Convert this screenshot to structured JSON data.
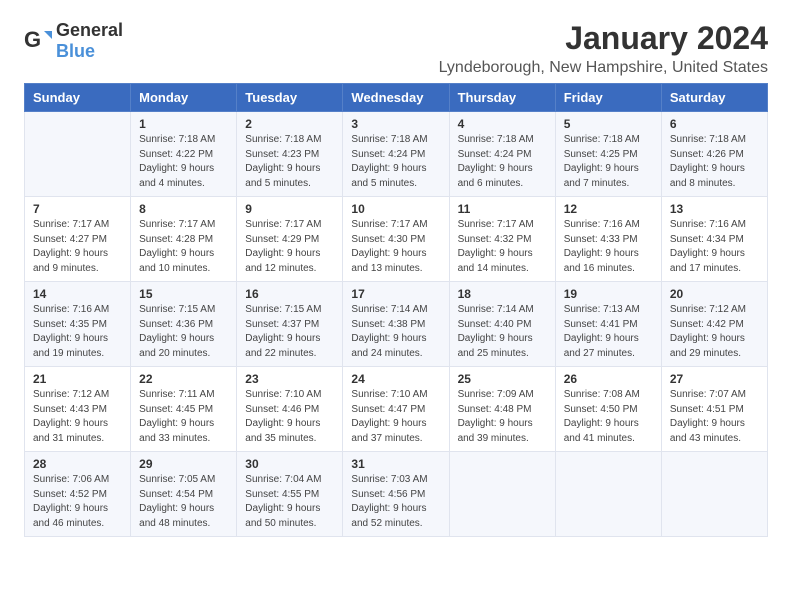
{
  "header": {
    "logo_general": "General",
    "logo_blue": "Blue",
    "title": "January 2024",
    "subtitle": "Lyndeborough, New Hampshire, United States"
  },
  "days_of_week": [
    "Sunday",
    "Monday",
    "Tuesday",
    "Wednesday",
    "Thursday",
    "Friday",
    "Saturday"
  ],
  "weeks": [
    [
      {
        "num": "",
        "sunrise": "",
        "sunset": "",
        "daylight": ""
      },
      {
        "num": "1",
        "sunrise": "Sunrise: 7:18 AM",
        "sunset": "Sunset: 4:22 PM",
        "daylight": "Daylight: 9 hours and 4 minutes."
      },
      {
        "num": "2",
        "sunrise": "Sunrise: 7:18 AM",
        "sunset": "Sunset: 4:23 PM",
        "daylight": "Daylight: 9 hours and 5 minutes."
      },
      {
        "num": "3",
        "sunrise": "Sunrise: 7:18 AM",
        "sunset": "Sunset: 4:24 PM",
        "daylight": "Daylight: 9 hours and 5 minutes."
      },
      {
        "num": "4",
        "sunrise": "Sunrise: 7:18 AM",
        "sunset": "Sunset: 4:24 PM",
        "daylight": "Daylight: 9 hours and 6 minutes."
      },
      {
        "num": "5",
        "sunrise": "Sunrise: 7:18 AM",
        "sunset": "Sunset: 4:25 PM",
        "daylight": "Daylight: 9 hours and 7 minutes."
      },
      {
        "num": "6",
        "sunrise": "Sunrise: 7:18 AM",
        "sunset": "Sunset: 4:26 PM",
        "daylight": "Daylight: 9 hours and 8 minutes."
      }
    ],
    [
      {
        "num": "7",
        "sunrise": "Sunrise: 7:17 AM",
        "sunset": "Sunset: 4:27 PM",
        "daylight": "Daylight: 9 hours and 9 minutes."
      },
      {
        "num": "8",
        "sunrise": "Sunrise: 7:17 AM",
        "sunset": "Sunset: 4:28 PM",
        "daylight": "Daylight: 9 hours and 10 minutes."
      },
      {
        "num": "9",
        "sunrise": "Sunrise: 7:17 AM",
        "sunset": "Sunset: 4:29 PM",
        "daylight": "Daylight: 9 hours and 12 minutes."
      },
      {
        "num": "10",
        "sunrise": "Sunrise: 7:17 AM",
        "sunset": "Sunset: 4:30 PM",
        "daylight": "Daylight: 9 hours and 13 minutes."
      },
      {
        "num": "11",
        "sunrise": "Sunrise: 7:17 AM",
        "sunset": "Sunset: 4:32 PM",
        "daylight": "Daylight: 9 hours and 14 minutes."
      },
      {
        "num": "12",
        "sunrise": "Sunrise: 7:16 AM",
        "sunset": "Sunset: 4:33 PM",
        "daylight": "Daylight: 9 hours and 16 minutes."
      },
      {
        "num": "13",
        "sunrise": "Sunrise: 7:16 AM",
        "sunset": "Sunset: 4:34 PM",
        "daylight": "Daylight: 9 hours and 17 minutes."
      }
    ],
    [
      {
        "num": "14",
        "sunrise": "Sunrise: 7:16 AM",
        "sunset": "Sunset: 4:35 PM",
        "daylight": "Daylight: 9 hours and 19 minutes."
      },
      {
        "num": "15",
        "sunrise": "Sunrise: 7:15 AM",
        "sunset": "Sunset: 4:36 PM",
        "daylight": "Daylight: 9 hours and 20 minutes."
      },
      {
        "num": "16",
        "sunrise": "Sunrise: 7:15 AM",
        "sunset": "Sunset: 4:37 PM",
        "daylight": "Daylight: 9 hours and 22 minutes."
      },
      {
        "num": "17",
        "sunrise": "Sunrise: 7:14 AM",
        "sunset": "Sunset: 4:38 PM",
        "daylight": "Daylight: 9 hours and 24 minutes."
      },
      {
        "num": "18",
        "sunrise": "Sunrise: 7:14 AM",
        "sunset": "Sunset: 4:40 PM",
        "daylight": "Daylight: 9 hours and 25 minutes."
      },
      {
        "num": "19",
        "sunrise": "Sunrise: 7:13 AM",
        "sunset": "Sunset: 4:41 PM",
        "daylight": "Daylight: 9 hours and 27 minutes."
      },
      {
        "num": "20",
        "sunrise": "Sunrise: 7:12 AM",
        "sunset": "Sunset: 4:42 PM",
        "daylight": "Daylight: 9 hours and 29 minutes."
      }
    ],
    [
      {
        "num": "21",
        "sunrise": "Sunrise: 7:12 AM",
        "sunset": "Sunset: 4:43 PM",
        "daylight": "Daylight: 9 hours and 31 minutes."
      },
      {
        "num": "22",
        "sunrise": "Sunrise: 7:11 AM",
        "sunset": "Sunset: 4:45 PM",
        "daylight": "Daylight: 9 hours and 33 minutes."
      },
      {
        "num": "23",
        "sunrise": "Sunrise: 7:10 AM",
        "sunset": "Sunset: 4:46 PM",
        "daylight": "Daylight: 9 hours and 35 minutes."
      },
      {
        "num": "24",
        "sunrise": "Sunrise: 7:10 AM",
        "sunset": "Sunset: 4:47 PM",
        "daylight": "Daylight: 9 hours and 37 minutes."
      },
      {
        "num": "25",
        "sunrise": "Sunrise: 7:09 AM",
        "sunset": "Sunset: 4:48 PM",
        "daylight": "Daylight: 9 hours and 39 minutes."
      },
      {
        "num": "26",
        "sunrise": "Sunrise: 7:08 AM",
        "sunset": "Sunset: 4:50 PM",
        "daylight": "Daylight: 9 hours and 41 minutes."
      },
      {
        "num": "27",
        "sunrise": "Sunrise: 7:07 AM",
        "sunset": "Sunset: 4:51 PM",
        "daylight": "Daylight: 9 hours and 43 minutes."
      }
    ],
    [
      {
        "num": "28",
        "sunrise": "Sunrise: 7:06 AM",
        "sunset": "Sunset: 4:52 PM",
        "daylight": "Daylight: 9 hours and 46 minutes."
      },
      {
        "num": "29",
        "sunrise": "Sunrise: 7:05 AM",
        "sunset": "Sunset: 4:54 PM",
        "daylight": "Daylight: 9 hours and 48 minutes."
      },
      {
        "num": "30",
        "sunrise": "Sunrise: 7:04 AM",
        "sunset": "Sunset: 4:55 PM",
        "daylight": "Daylight: 9 hours and 50 minutes."
      },
      {
        "num": "31",
        "sunrise": "Sunrise: 7:03 AM",
        "sunset": "Sunset: 4:56 PM",
        "daylight": "Daylight: 9 hours and 52 minutes."
      },
      {
        "num": "",
        "sunrise": "",
        "sunset": "",
        "daylight": ""
      },
      {
        "num": "",
        "sunrise": "",
        "sunset": "",
        "daylight": ""
      },
      {
        "num": "",
        "sunrise": "",
        "sunset": "",
        "daylight": ""
      }
    ]
  ]
}
